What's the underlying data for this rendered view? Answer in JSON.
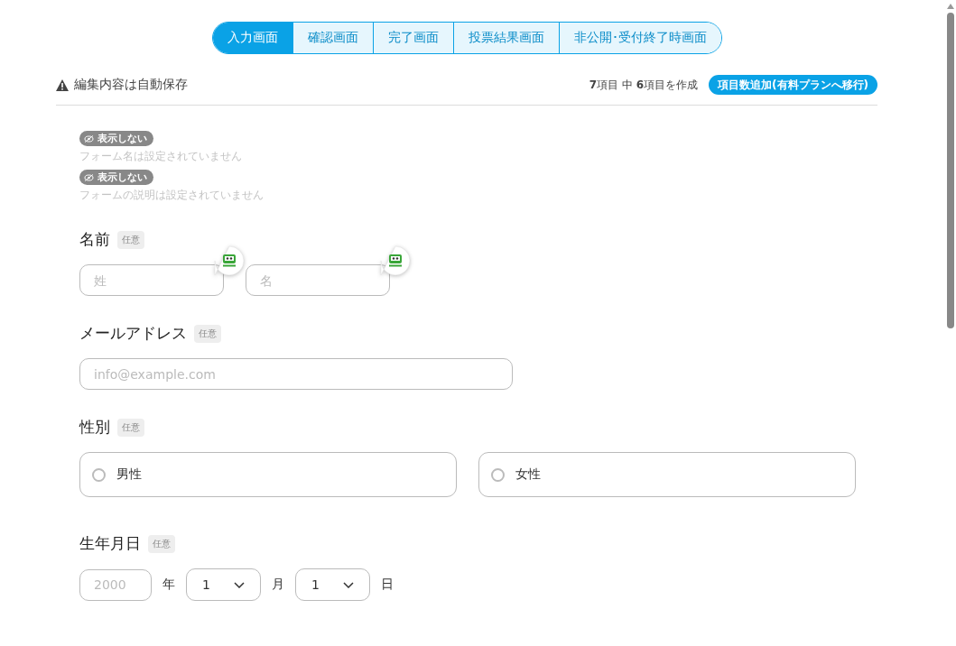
{
  "tabs": [
    {
      "label": "入力画面",
      "selected": true
    },
    {
      "label": "確認画面",
      "selected": false
    },
    {
      "label": "完了画面",
      "selected": false
    },
    {
      "label": "投票結果画面",
      "selected": false
    },
    {
      "label": "非公開･受付終了時画面",
      "selected": false
    }
  ],
  "header": {
    "notice": "編集内容は自動保存",
    "counter": "**7**項目 中 **6**項目を作成",
    "upgrade_button": "項目数追加(有料プランへ移行)"
  },
  "hidden_items": [
    {
      "badge": "表示しない",
      "text": "フォーム名は設定されていません"
    },
    {
      "badge": "表示しない",
      "text": "フォームの説明は設定されていません"
    }
  ],
  "fields": [
    {
      "kind": "name",
      "label": "名前",
      "badge": "任意",
      "inputs": [
        {
          "placeholder": "姓"
        },
        {
          "placeholder": "名"
        }
      ]
    },
    {
      "kind": "email",
      "label": "メールアドレス",
      "badge": "任意",
      "placeholder": "info@example.com"
    },
    {
      "kind": "radio",
      "label": "性別",
      "badge": "任意",
      "options": [
        {
          "label": "男性",
          "selected": false
        },
        {
          "label": "女性",
          "selected": false
        }
      ]
    },
    {
      "kind": "date",
      "label": "生年月日",
      "badge": "任意",
      "parts": [
        {
          "kind": "input",
          "placeholder": "2000"
        },
        {
          "kind": "unit",
          "text": "年"
        },
        {
          "kind": "select",
          "value": "1"
        },
        {
          "kind": "unit",
          "text": "月"
        },
        {
          "kind": "select",
          "value": "1"
        },
        {
          "kind": "unit",
          "text": "日"
        }
      ]
    }
  ]
}
